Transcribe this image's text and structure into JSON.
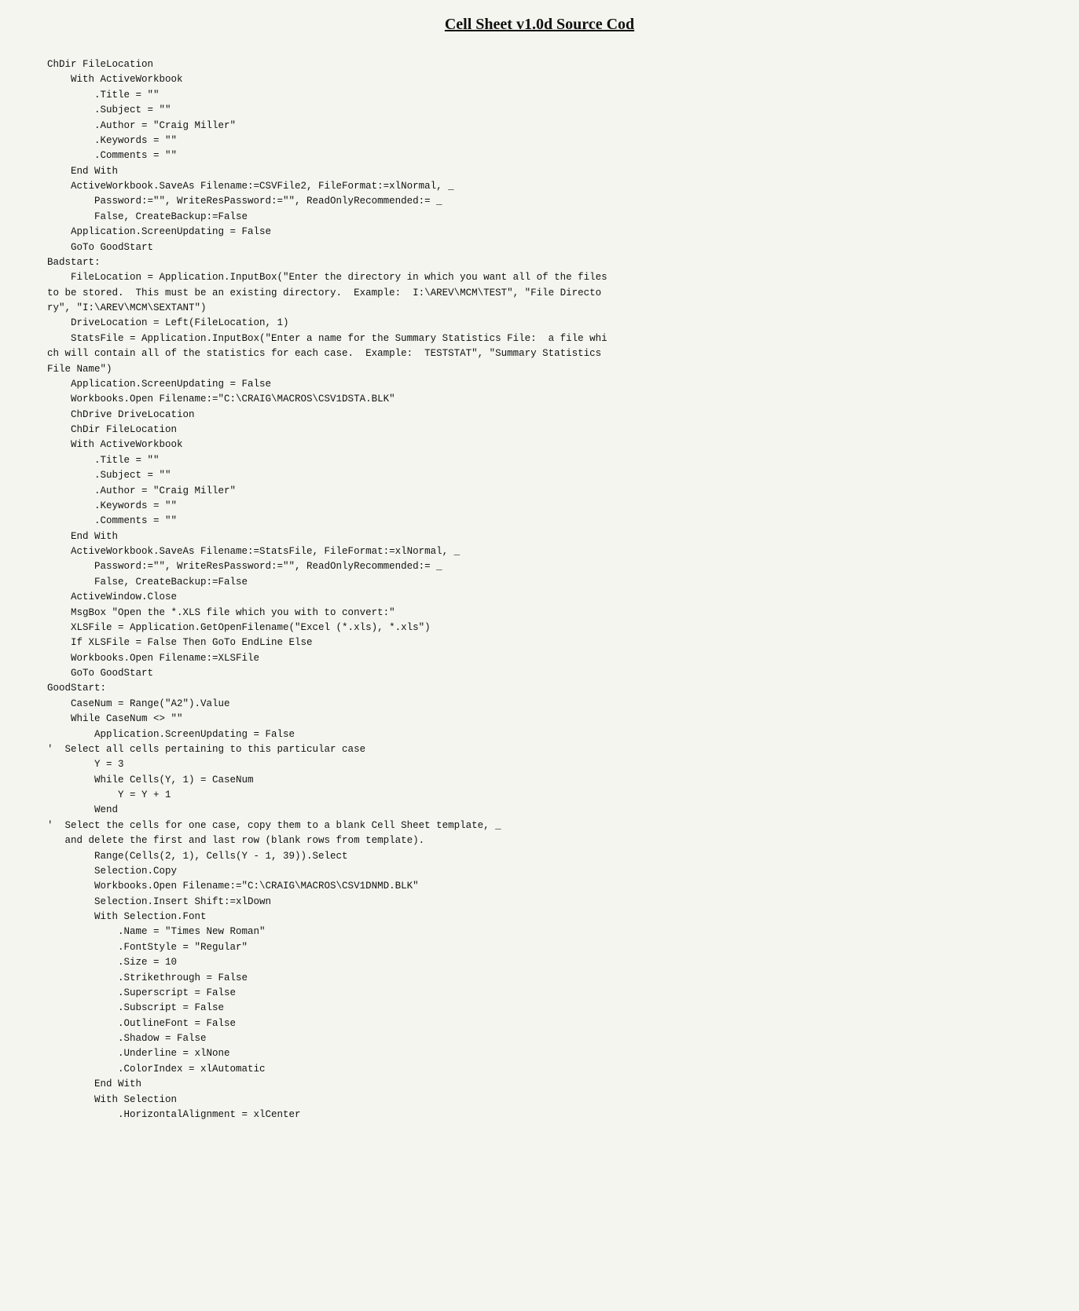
{
  "page": {
    "title": "Cell Sheet v1.0d Source Cod",
    "code": [
      "ChDir FileLocation",
      "    With ActiveWorkbook",
      "        .Title = \"\"",
      "        .Subject = \"\"",
      "        .Author = \"Craig Miller\"",
      "        .Keywords = \"\"",
      "        .Comments = \"\"",
      "    End With",
      "    ActiveWorkbook.SaveAs Filename:=CSVFile2, FileFormat:=xlNormal, _",
      "        Password:=\"\", WriteResPassword:=\"\", ReadOnlyRecommended:= _",
      "        False, CreateBackup:=False",
      "    Application.ScreenUpdating = False",
      "    GoTo GoodStart",
      "Badstart:",
      "    FileLocation = Application.InputBox(\"Enter the directory in which you want all of the files",
      "to be stored.  This must be an existing directory.  Example:  I:\\AREV\\MCM\\TEST\", \"File Directo",
      "ry\", \"I:\\AREV\\MCM\\SEXTANT\")",
      "    DriveLocation = Left(FileLocation, 1)",
      "    StatsFile = Application.InputBox(\"Enter a name for the Summary Statistics File:  a file whi",
      "ch will contain all of the statistics for each case.  Example:  TESTSTAT\", \"Summary Statistics",
      "File Name\")",
      "    Application.ScreenUpdating = False",
      "    Workbooks.Open Filename:=\"C:\\CRAIG\\MACROS\\CSV1DSTA.BLK\"",
      "    ChDrive DriveLocation",
      "    ChDir FileLocation",
      "    With ActiveWorkbook",
      "        .Title = \"\"",
      "        .Subject = \"\"",
      "        .Author = \"Craig Miller\"",
      "        .Keywords = \"\"",
      "        .Comments = \"\"",
      "    End With",
      "    ActiveWorkbook.SaveAs Filename:=StatsFile, FileFormat:=xlNormal, _",
      "        Password:=\"\", WriteResPassword:=\"\", ReadOnlyRecommended:= _",
      "        False, CreateBackup:=False",
      "    ActiveWindow.Close",
      "    MsgBox \"Open the *.XLS file which you with to convert:\"",
      "    XLSFile = Application.GetOpenFilename(\"Excel (*.xls), *.xls\")",
      "    If XLSFile = False Then GoTo EndLine Else",
      "    Workbooks.Open Filename:=XLSFile",
      "    GoTo GoodStart",
      "GoodStart:",
      "    CaseNum = Range(\"A2\").Value",
      "    While CaseNum <> \"\"",
      "        Application.ScreenUpdating = False",
      "'  Select all cells pertaining to this particular case",
      "        Y = 3",
      "        While Cells(Y, 1) = CaseNum",
      "            Y = Y + 1",
      "        Wend",
      "'  Select the cells for one case, copy them to a blank Cell Sheet template, _",
      "   and delete the first and last row (blank rows from template).",
      "        Range(Cells(2, 1), Cells(Y - 1, 39)).Select",
      "        Selection.Copy",
      "        Workbooks.Open Filename:=\"C:\\CRAIG\\MACROS\\CSV1DNMD.BLK\"",
      "        Selection.Insert Shift:=xlDown",
      "        With Selection.Font",
      "            .Name = \"Times New Roman\"",
      "            .FontStyle = \"Regular\"",
      "            .Size = 10",
      "            .Strikethrough = False",
      "            .Superscript = False",
      "            .Subscript = False",
      "            .OutlineFont = False",
      "            .Shadow = False",
      "            .Underline = xlNone",
      "            .ColorIndex = xlAutomatic",
      "        End With",
      "        With Selection",
      "            .HorizontalAlignment = xlCenter"
    ]
  }
}
